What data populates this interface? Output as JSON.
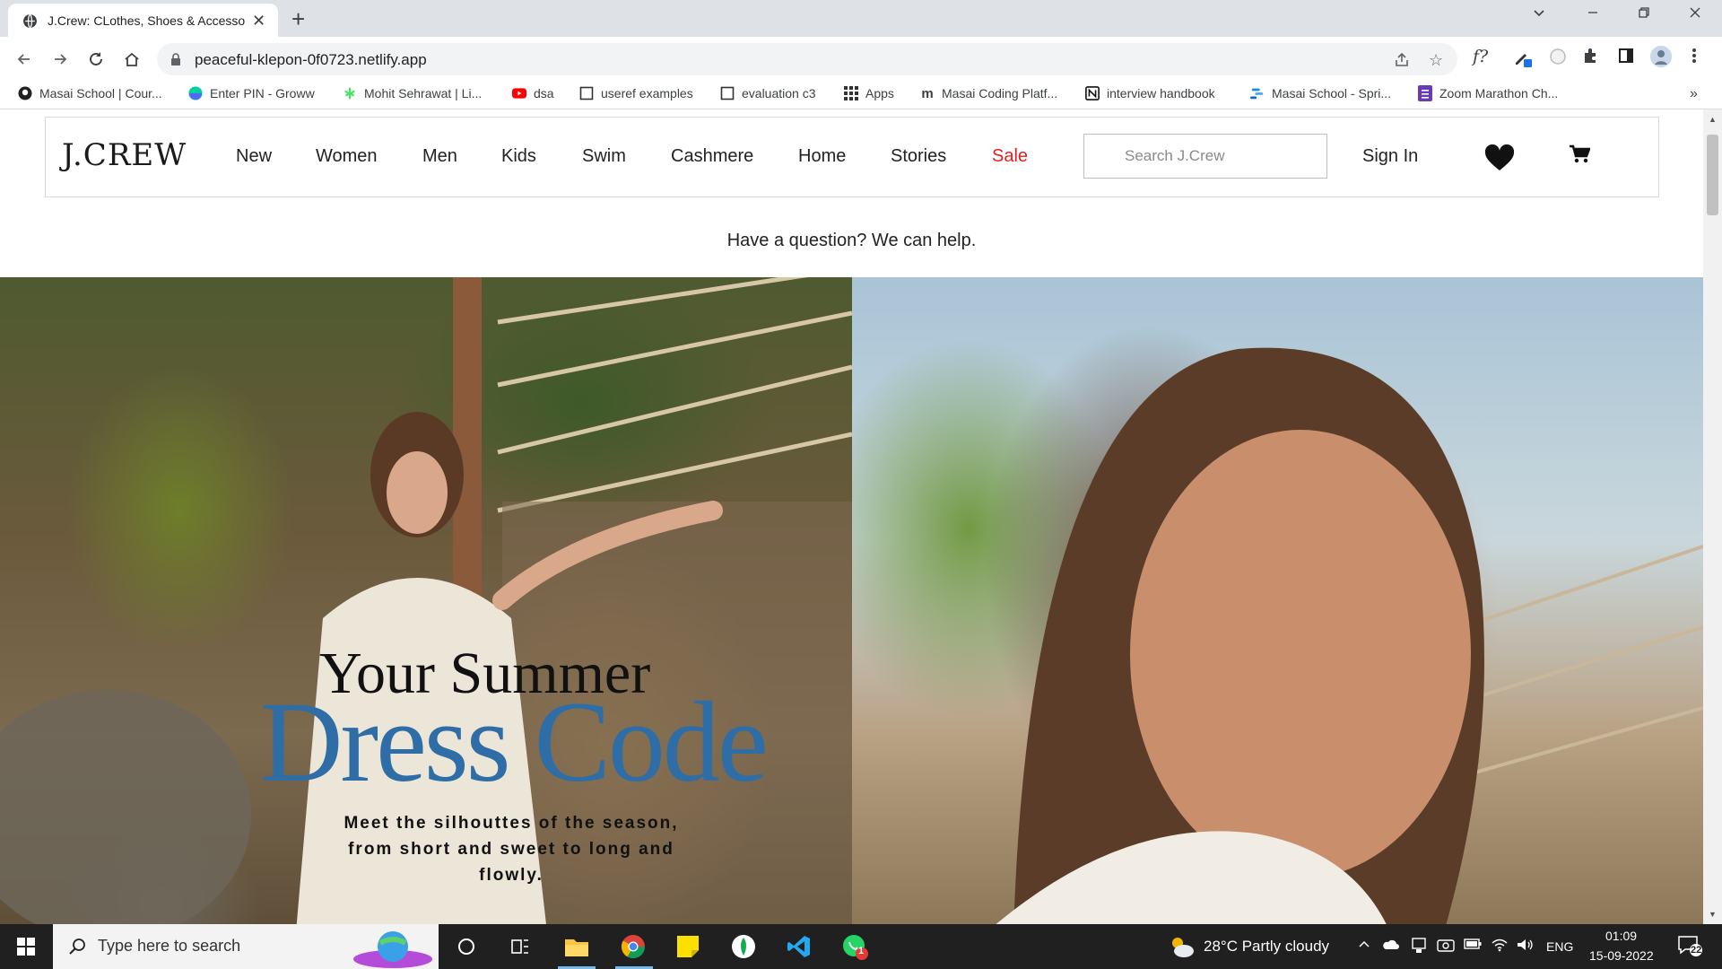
{
  "browser": {
    "tab_title": "J.Crew: CLothes, Shoes & Accesso",
    "url": "peaceful-klepon-0f0723.netlify.app",
    "bookmarks": [
      {
        "label": "Masai School | Cour...",
        "icon": "github-icon"
      },
      {
        "label": "Enter PIN - Groww",
        "icon": "groww-icon"
      },
      {
        "label": "Mohit Sehrawat | Li...",
        "icon": "linktree-icon"
      },
      {
        "label": "dsa",
        "icon": "youtube-icon"
      },
      {
        "label": "useref examples",
        "icon": "page-icon"
      },
      {
        "label": "evaluation c3",
        "icon": "page-icon"
      },
      {
        "label": "Apps",
        "icon": "apps-grid-icon"
      },
      {
        "label": "Masai Coding Platf...",
        "icon": "masai-icon"
      },
      {
        "label": "interview handbook",
        "icon": "notion-icon"
      },
      {
        "label": "Masai School - Spri...",
        "icon": "masai-sprint-icon"
      },
      {
        "label": "Zoom Marathon Ch...",
        "icon": "form-icon"
      }
    ],
    "extension_label": "f?"
  },
  "site": {
    "logo": "J.CREW",
    "nav": [
      "New",
      "Women",
      "Men",
      "Kids",
      "Swim",
      "Cashmere",
      "Home",
      "Stories",
      "Sale"
    ],
    "search_placeholder": "Search J.Crew",
    "signin": "Sign In",
    "help_text": "Have a question? We can help.",
    "hero": {
      "line1": "Your Summer",
      "line2": "Dress Code",
      "body": "Meet the silhouttes of the season, from short and sweet to long and flowly."
    },
    "colors": {
      "sale": "#e41f1f",
      "hero_accent": "#2e6da6"
    }
  },
  "taskbar": {
    "search_placeholder": "Type here to search",
    "weather": "28°C  Partly cloudy",
    "lang": "ENG",
    "time": "01:09",
    "date": "15-09-2022",
    "whatsapp_badge": "1",
    "notifications": "22"
  }
}
